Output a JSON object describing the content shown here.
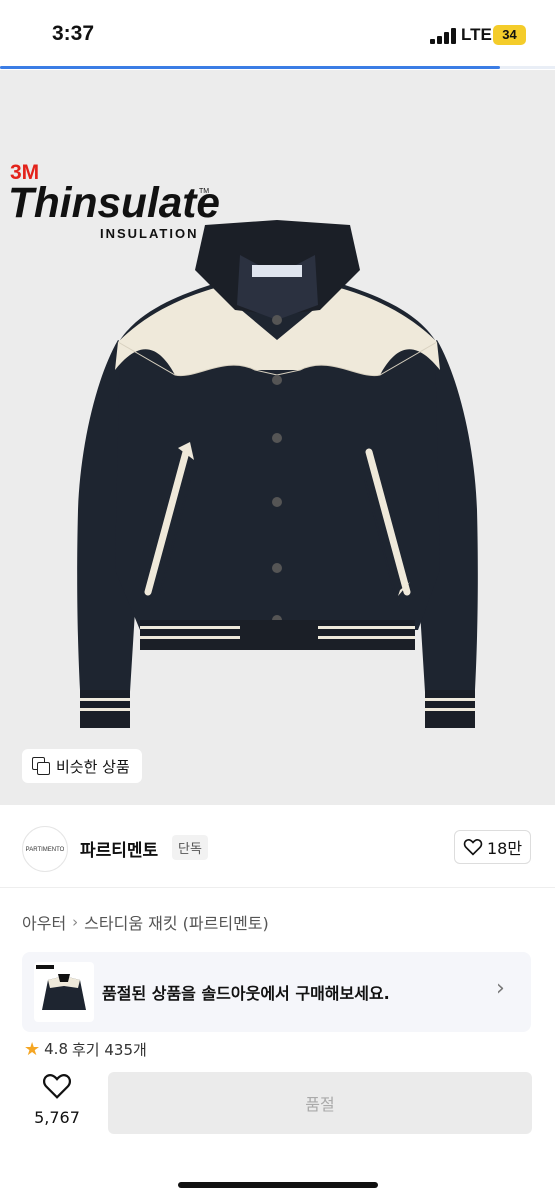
{
  "status_bar": {
    "time": "3:37",
    "network": "LTE",
    "battery": "34"
  },
  "progress": {
    "fraction": 0.9
  },
  "image_overlay": {
    "brand_mark": "3M",
    "product_name": "Thinsulate",
    "tagline": "INSULATION",
    "trademark": "TM"
  },
  "similar_button": {
    "label": "비슷한 상품",
    "icon": "copy-icon"
  },
  "brand": {
    "logo_text": "PARTIMENTO",
    "name": "파르티멘토",
    "badge": "단독",
    "likes": "18만"
  },
  "breadcrumb": {
    "category": "아우터",
    "separator": "›",
    "product": "스타디움 재킷 (파르티멘토)"
  },
  "soldout_banner": {
    "text": "품절된 상품을 솔드아웃에서 구매해보세요.",
    "chevron": "›"
  },
  "rating": {
    "score": "4.8",
    "reviews": "후기 435개"
  },
  "bottom_bar": {
    "wish_count": "5,767",
    "buy_label": "품절"
  },
  "colors": {
    "accent": "#3b7de5",
    "battery": "#f4cc2a",
    "jacket_body": "#1e2530",
    "jacket_cream": "#efe9da"
  }
}
